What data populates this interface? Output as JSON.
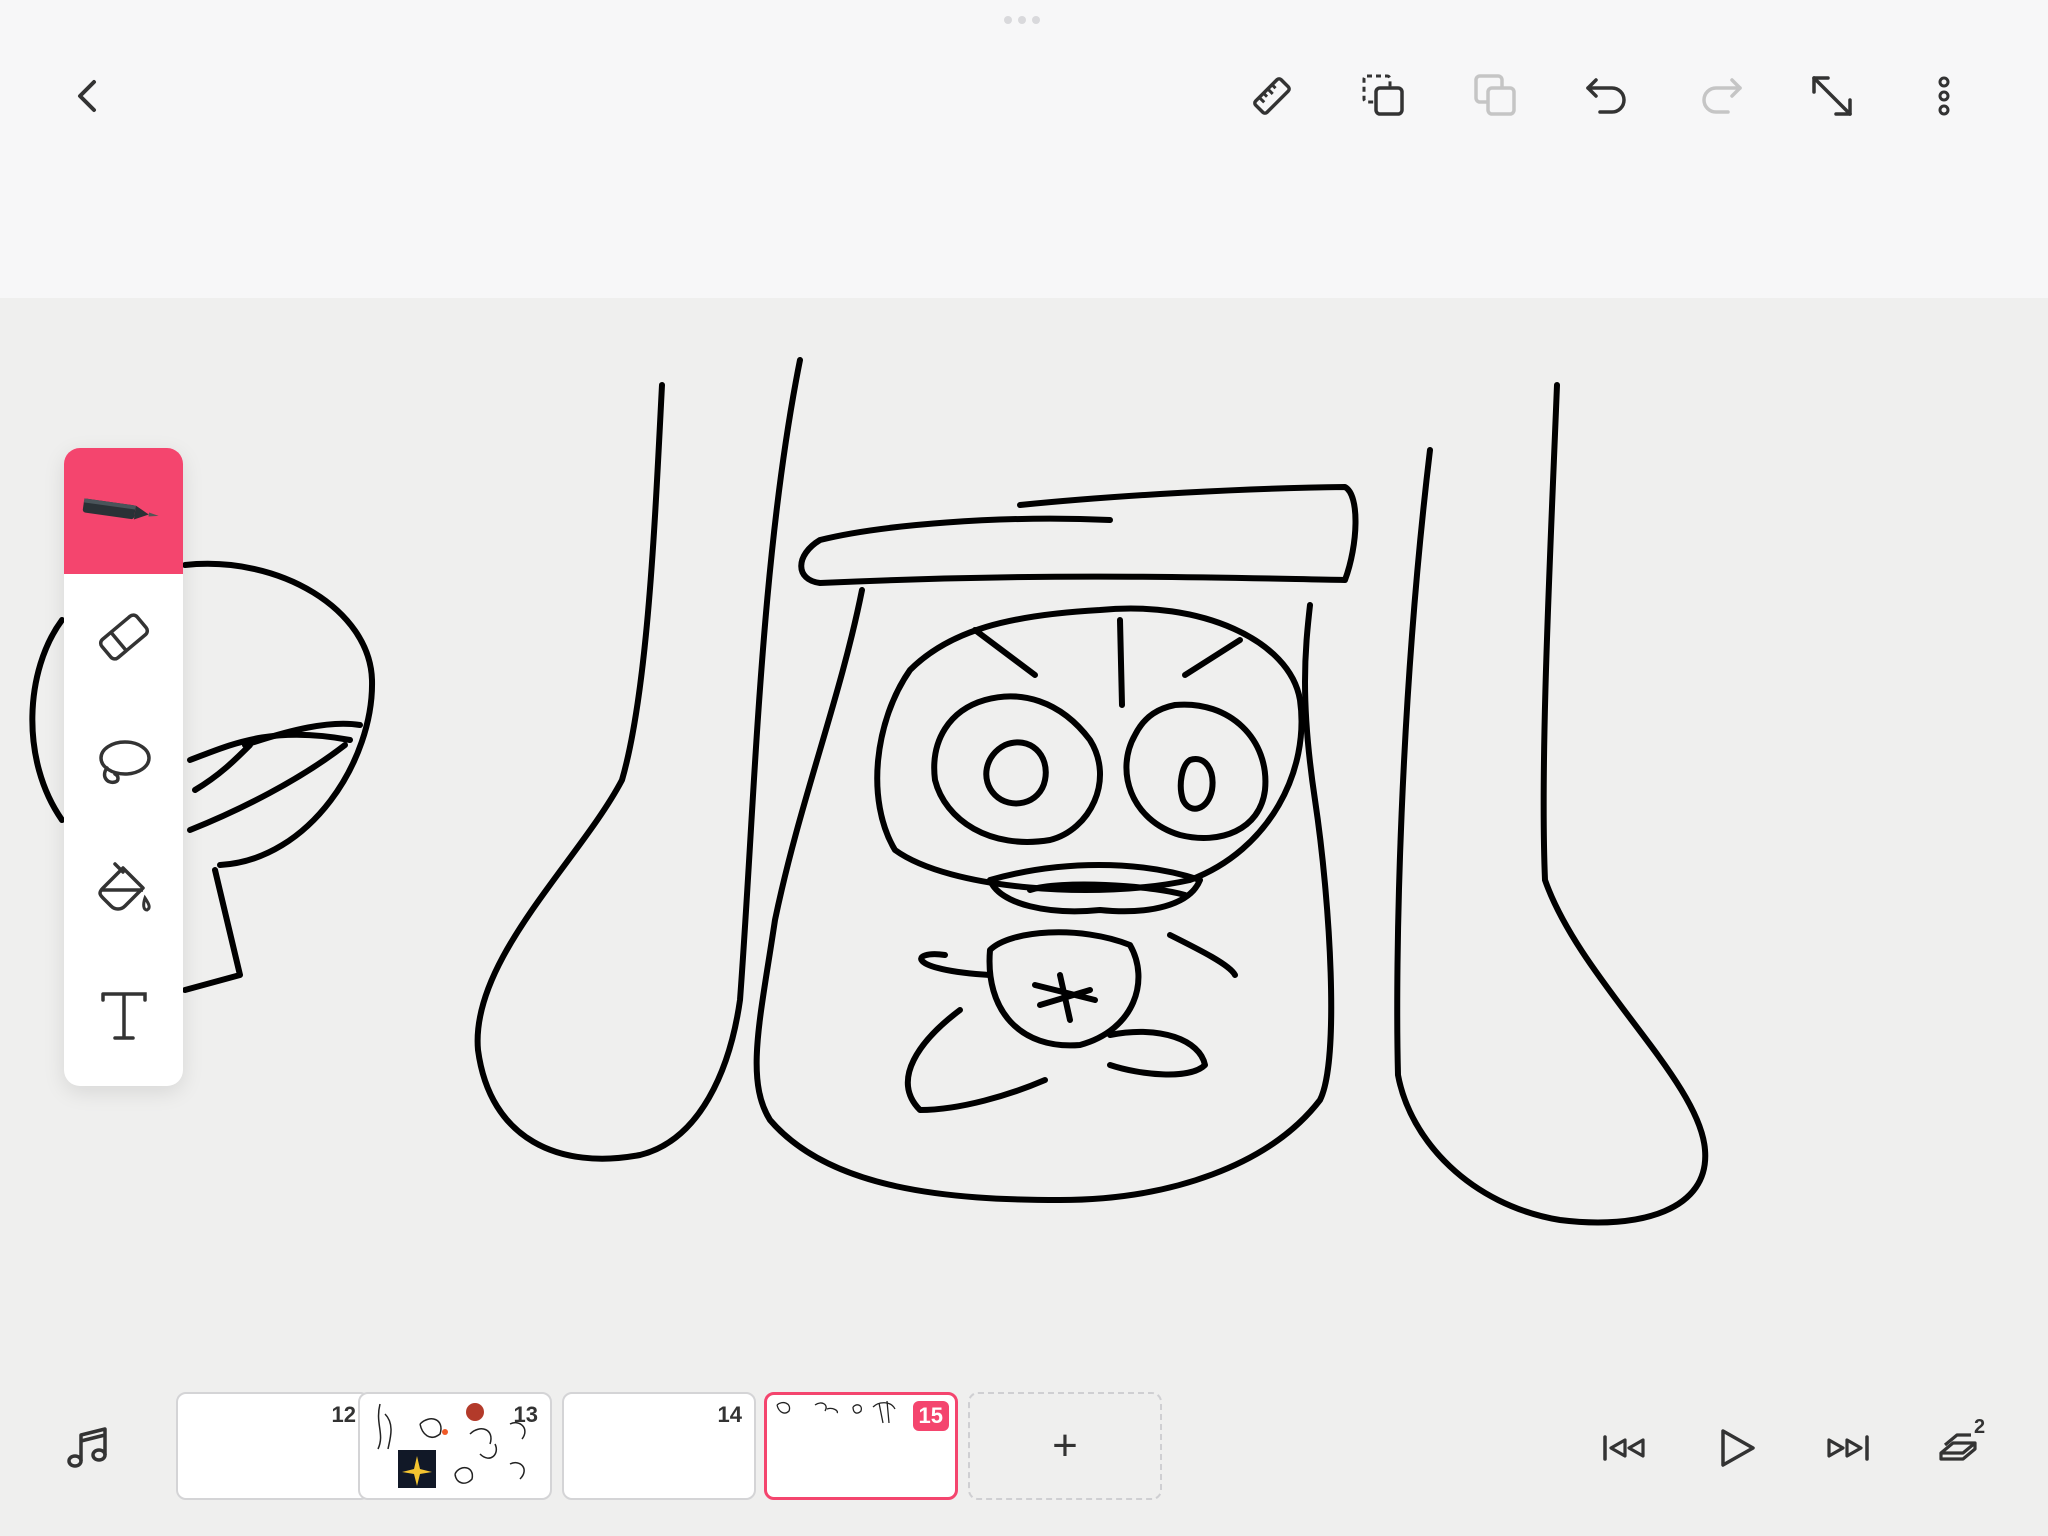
{
  "app": {
    "accent_color": "#f4456e"
  },
  "topbar": {
    "back": {
      "icon": "chevron-left-icon"
    },
    "actions": [
      {
        "name": "ruler-button",
        "icon": "ruler-icon",
        "enabled": true
      },
      {
        "name": "copy-button",
        "icon": "copy-dashed-icon",
        "enabled": true
      },
      {
        "name": "paste-button",
        "icon": "paste-icon",
        "enabled": false
      },
      {
        "name": "undo-button",
        "icon": "undo-icon",
        "enabled": true
      },
      {
        "name": "redo-button",
        "icon": "redo-icon",
        "enabled": false
      },
      {
        "name": "expand-button",
        "icon": "expand-diagonal-icon",
        "enabled": true
      },
      {
        "name": "more-button",
        "icon": "more-vertical-icon",
        "enabled": true
      }
    ]
  },
  "tools": [
    {
      "name": "pen",
      "icon": "pen-icon",
      "active": true
    },
    {
      "name": "eraser",
      "icon": "eraser-icon",
      "active": false
    },
    {
      "name": "lasso",
      "icon": "lasso-icon",
      "active": false
    },
    {
      "name": "fill",
      "icon": "paint-bucket-icon",
      "active": false
    },
    {
      "name": "text",
      "icon": "text-icon",
      "active": false
    }
  ],
  "timeline": {
    "frames": [
      {
        "number": "12",
        "selected": false
      },
      {
        "number": "13",
        "selected": false
      },
      {
        "number": "14",
        "selected": false
      },
      {
        "number": "15",
        "selected": true
      }
    ],
    "add_label": "+",
    "layers_count": "2"
  },
  "playback": [
    {
      "name": "music-button",
      "icon": "music-icon"
    },
    {
      "name": "skip-start-button",
      "icon": "skip-start-icon"
    },
    {
      "name": "play-button",
      "icon": "play-icon"
    },
    {
      "name": "skip-end-button",
      "icon": "skip-end-icon"
    },
    {
      "name": "layers-button",
      "icon": "layers-icon"
    }
  ]
}
